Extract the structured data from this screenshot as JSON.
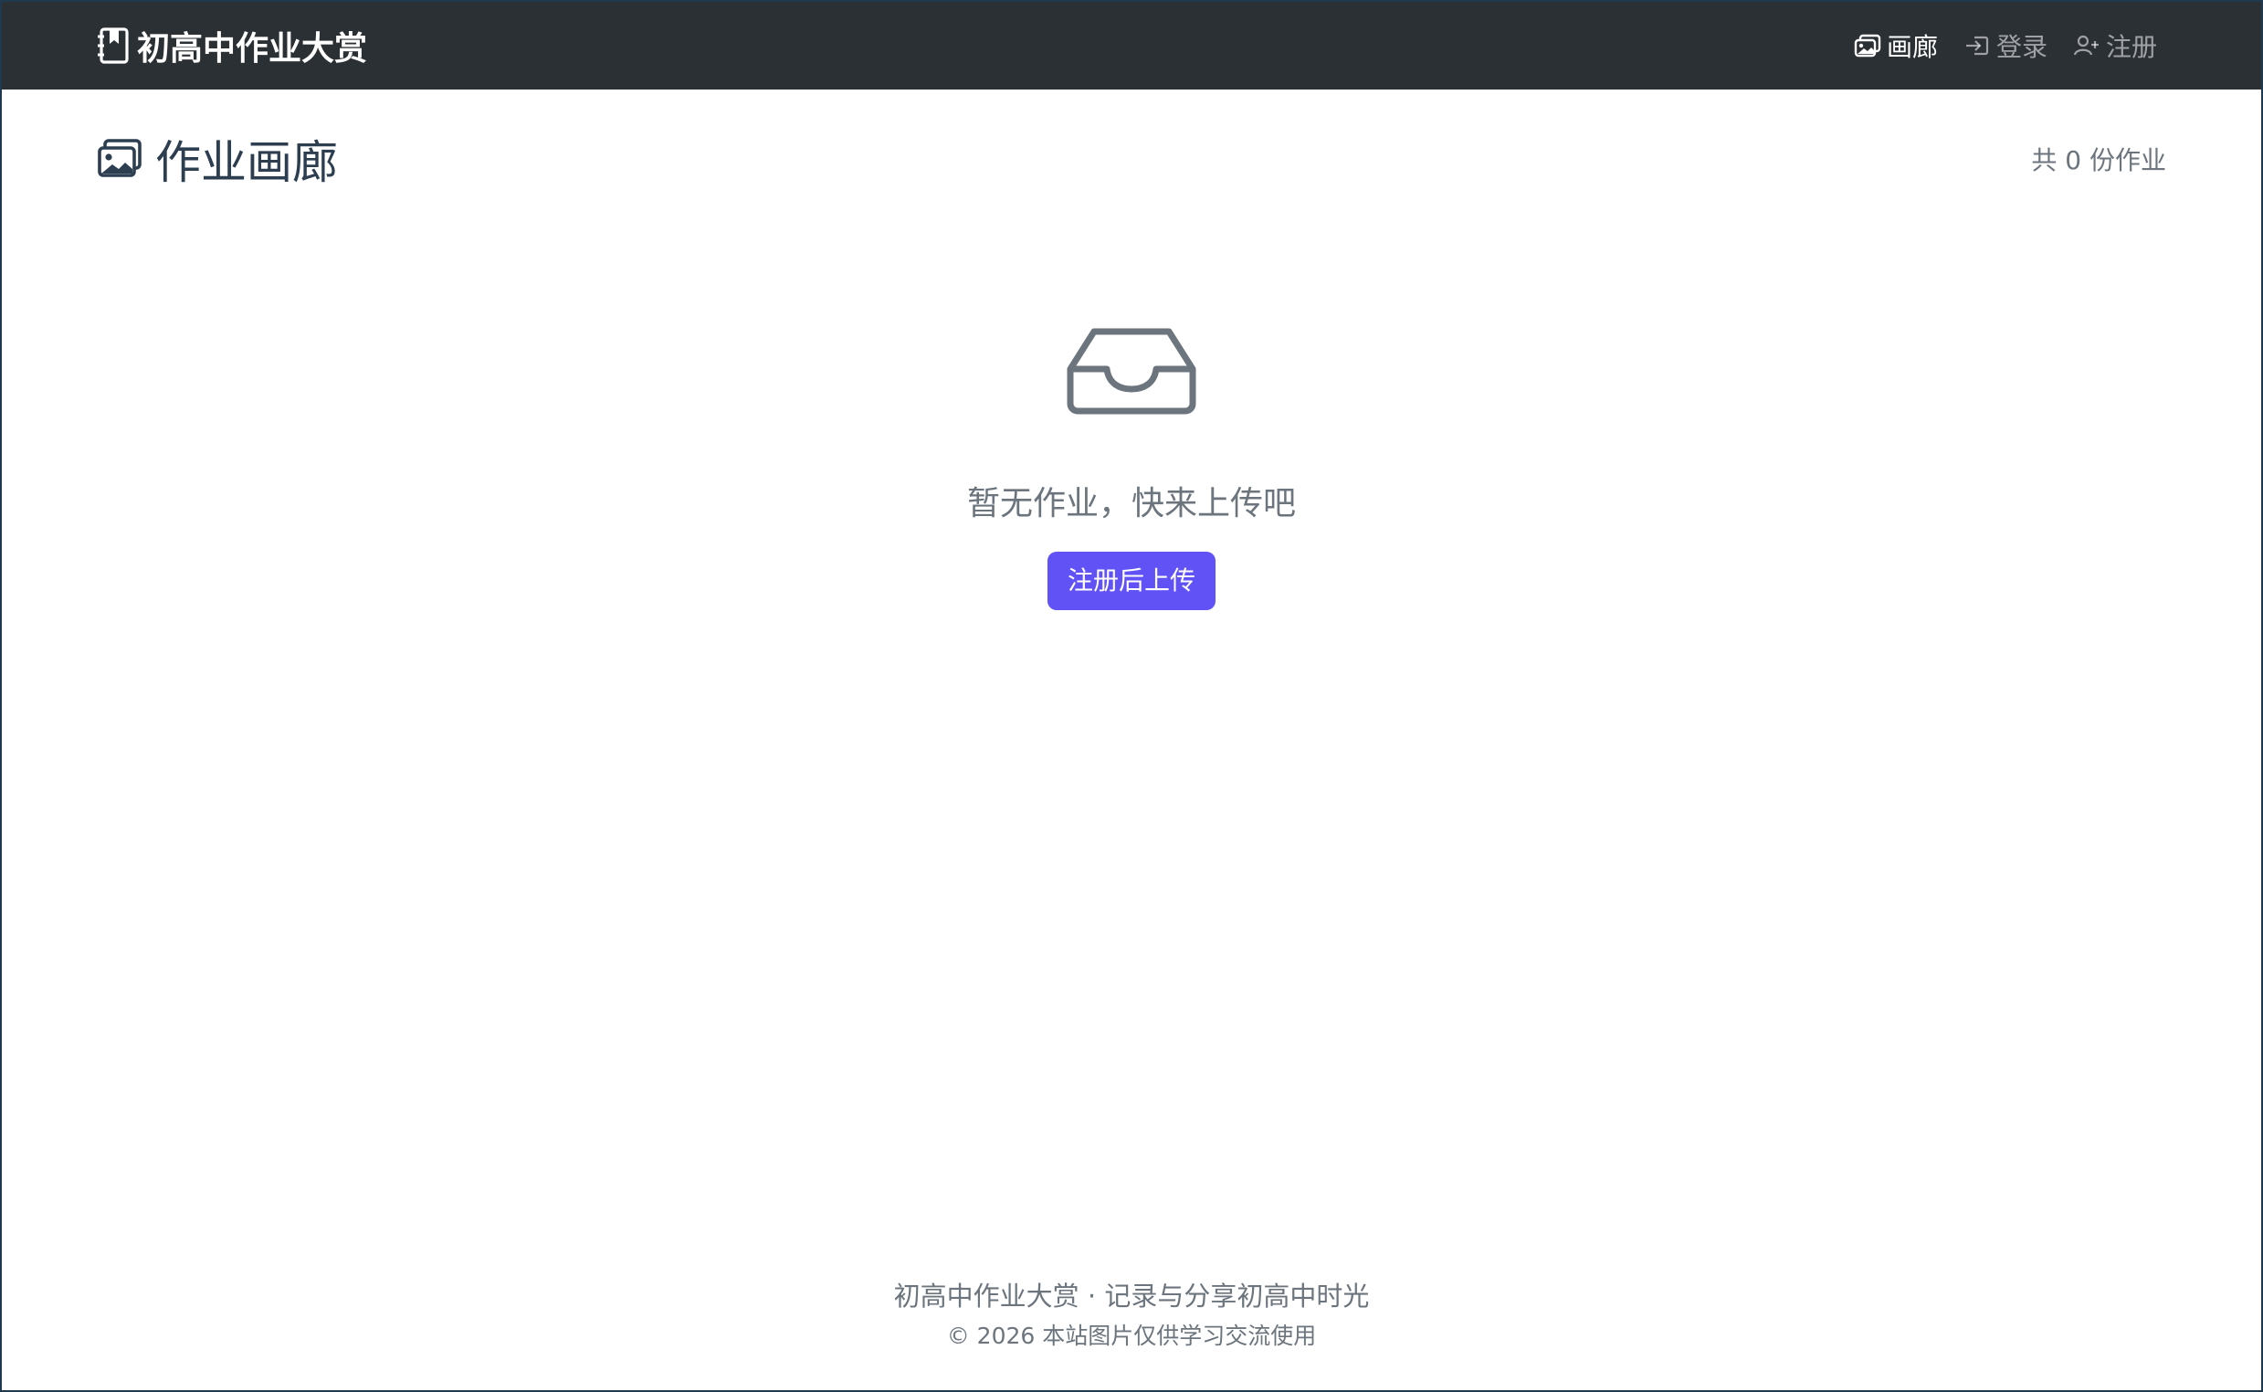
{
  "navbar": {
    "brand_text": "初高中作业大赏",
    "brand_icon": "journal-bookmark-icon",
    "links": [
      {
        "label": "画廊",
        "icon": "images-icon",
        "active": true
      },
      {
        "label": "登录",
        "icon": "box-arrow-in-right-icon",
        "active": false
      },
      {
        "label": "注册",
        "icon": "person-plus-icon",
        "active": false
      }
    ],
    "bg_color": "#2b3035"
  },
  "header": {
    "title": "作业画廊",
    "title_icon": "images-icon",
    "count_text": "共 0 份作业"
  },
  "empty_state": {
    "icon": "inbox-icon",
    "message": "暂无作业，快来上传吧",
    "button_label": "注册后上传",
    "button_color": "#6152f5"
  },
  "footer": {
    "line1": "初高中作业大赏 · 记录与分享初高中时光",
    "line2": "© 2026 本站图片仅供学习交流使用"
  }
}
